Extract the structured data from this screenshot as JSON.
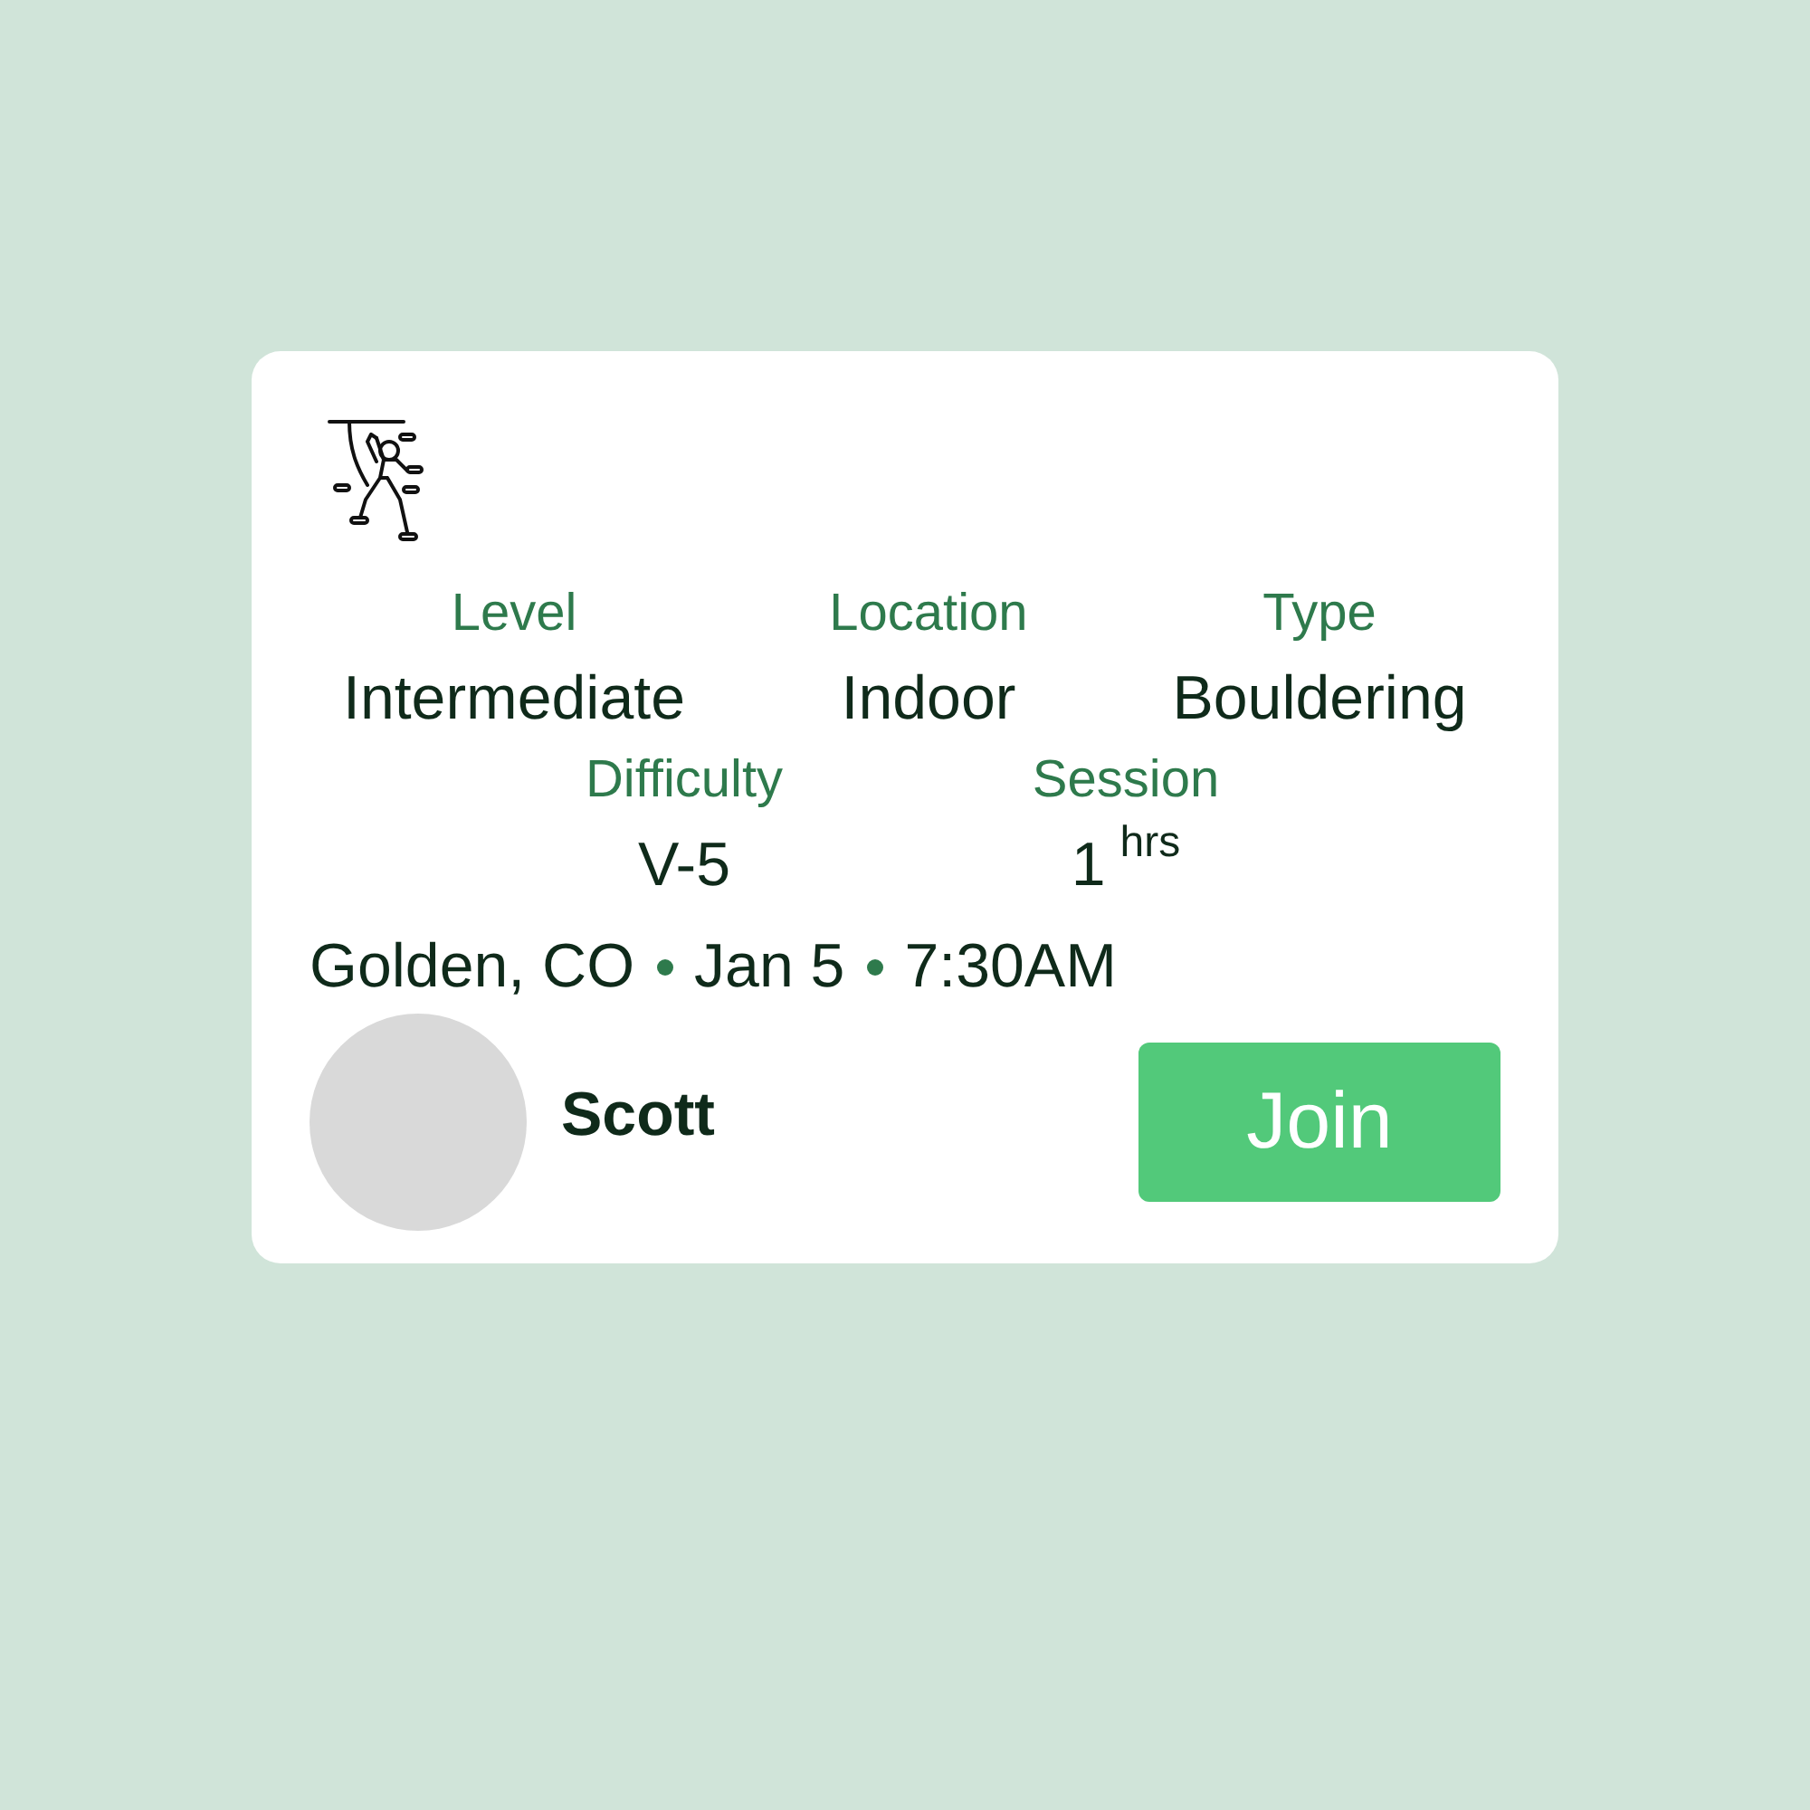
{
  "card": {
    "stats_top": [
      {
        "label": "Level",
        "value": "Intermediate"
      },
      {
        "label": "Location",
        "value": "Indoor"
      },
      {
        "label": "Type",
        "value": "Bouldering"
      }
    ],
    "stats_bottom": [
      {
        "label": "Difficulty",
        "value": "V-5"
      },
      {
        "label": "Session",
        "value": "1",
        "unit": "hrs"
      }
    ],
    "details": [
      "Golden, CO",
      "Jan 5",
      "7:30AM"
    ],
    "host": {
      "name": "Scott"
    },
    "join_button": {
      "label": "Join"
    }
  }
}
